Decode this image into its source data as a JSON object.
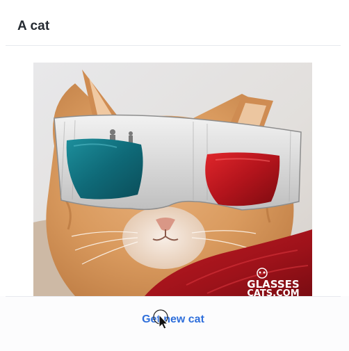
{
  "card": {
    "title": "A cat"
  },
  "image": {
    "watermark_line1": "GLASSES",
    "watermark_line2": "CATS.COM"
  },
  "actions": {
    "new_cat_label": "Get new cat"
  },
  "colors": {
    "title": "#252a31",
    "link": "#2f6fdb",
    "divider": "#e7e9ee"
  }
}
